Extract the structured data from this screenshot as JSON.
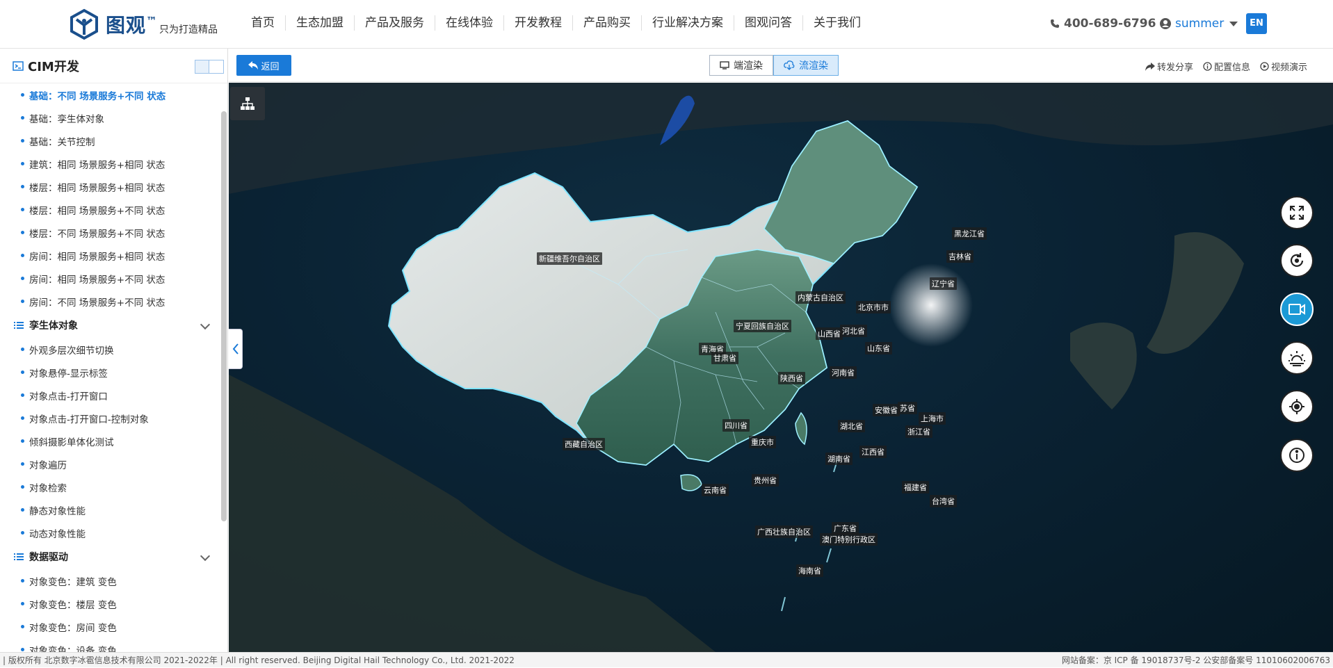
{
  "brand": {
    "name": "图观",
    "tm": "™",
    "slogan": "只为打造精品"
  },
  "nav": [
    "首页",
    "生态加盟",
    "产品及服务",
    "在线体验",
    "开发教程",
    "产品购买",
    "行业解决方案",
    "图观问答",
    "关于我们"
  ],
  "phone": "400-689-6796",
  "user": "summer",
  "lang": "EN",
  "sidebar": {
    "title": "CIM开发",
    "items_a": [
      "基础：不同 场景服务+不同 状态",
      "基础：孪生体对象",
      "基础：关节控制",
      "建筑：相同 场景服务+相同 状态",
      "楼层：相同 场景服务+相同 状态",
      "楼层：相同 场景服务+不同 状态",
      "楼层：不同 场景服务+不同 状态",
      "房间：相同 场景服务+相同 状态",
      "房间：相同 场景服务+不同 状态",
      "房间：不同 场景服务+不同 状态"
    ],
    "group_b": "孪生体对象",
    "items_b": [
      "外观多层次细节切换",
      "对象悬停-显示标签",
      "对象点击-打开窗口",
      "对象点击-打开窗口-控制对象",
      "倾斜摄影单体化测试",
      "对象遍历",
      "对象检索",
      "静态对象性能",
      "动态对象性能"
    ],
    "group_c": "数据驱动",
    "items_c": [
      "对象变色：建筑 变色",
      "对象变色：楼层 变色",
      "对象变色：房间 变色",
      "对象变色：设备 变色"
    ]
  },
  "toolbar": {
    "back": "返回",
    "render_client": "端渲染",
    "render_stream": "流渲染",
    "share": "转发分享",
    "config": "配置信息",
    "video": "视频演示"
  },
  "map": {
    "provinces": [
      "新疆维吾尔自治区",
      "西藏自治区",
      "青海省",
      "甘肃省",
      "宁夏回族自治区",
      "内蒙古自治区",
      "黑龙江省",
      "吉林省",
      "辽宁省",
      "北京市市",
      "山西省",
      "河北省",
      "山东省",
      "陕西省",
      "河南省",
      "四川省",
      "重庆市",
      "湖北省",
      "安徽省",
      "苏省",
      "上海市",
      "浙江省",
      "湖南省",
      "江西省",
      "贵州省",
      "云南省",
      "福建省",
      "台湾省",
      "广西壮族自治区",
      "广东省",
      "澳门特别行政区",
      "海南省"
    ]
  },
  "footer": {
    "left": "| 版权所有 北京数字冰雹信息技术有限公司 2021-2022年 | All right reserved. Beijing Digital Hail Technology Co., Ltd. 2021-2022",
    "right": "网站备案：京 ICP 备 19018737号-2 公安部备案号 11010602006763"
  },
  "colors": {
    "accent": "#1a7ad8",
    "map_sea": "#0a2233",
    "active_ctrl": "#1b9ad6"
  }
}
